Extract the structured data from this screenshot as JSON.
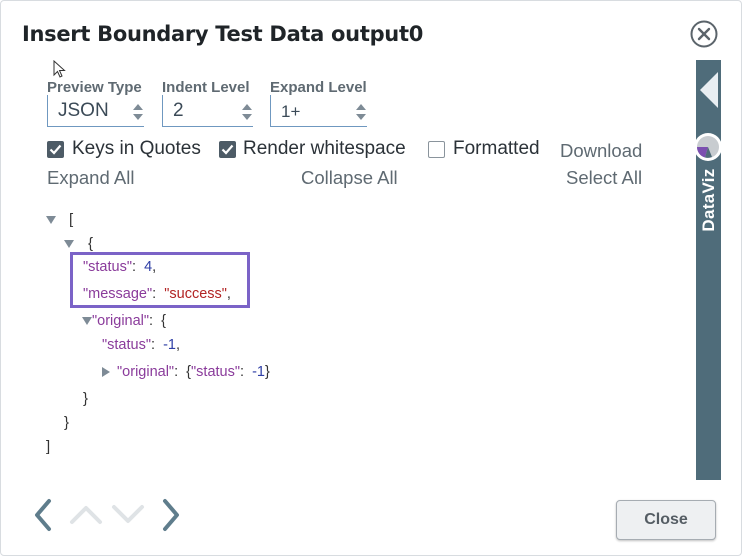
{
  "dialog": {
    "title": "Insert Boundary Test Data output0",
    "close_button": "Close"
  },
  "controls": {
    "preview_type": {
      "label": "Preview Type",
      "value": "JSON"
    },
    "indent_level": {
      "label": "Indent Level",
      "value": "2"
    },
    "expand_level": {
      "label": "Expand Level",
      "value": "1+"
    }
  },
  "options": {
    "keys_in_quotes": {
      "label": "Keys in Quotes",
      "checked": true
    },
    "render_whitespace": {
      "label": "Render whitespace",
      "checked": true
    },
    "formatted": {
      "label": "Formatted",
      "checked": false
    },
    "download": "Download",
    "expand_all": "Expand All",
    "collapse_all": "Collapse All",
    "select_all": "Select All"
  },
  "tree": {
    "open_bracket": "[",
    "open_brace": "{",
    "status_key": "\"status\"",
    "status_value": "4",
    "message_key": "\"message\"",
    "message_value": "\"success\"",
    "original_key": "\"original\"",
    "original_open": "{",
    "inner_status_key": "\"status\"",
    "inner_status_value": "-1",
    "inner_original_key": "\"original\"",
    "inner_original_preview_key": "\"status\"",
    "inner_original_preview_value": "-1",
    "close_original": "}",
    "close_brace": "}",
    "close_bracket": "]"
  },
  "sidebar": {
    "label": "DataViz",
    "color": "#4f6c7a"
  },
  "colors": {
    "highlight": "#7b63c7",
    "key": "#8a3b9b",
    "number": "#2f3fa6",
    "string": "#b22424"
  }
}
